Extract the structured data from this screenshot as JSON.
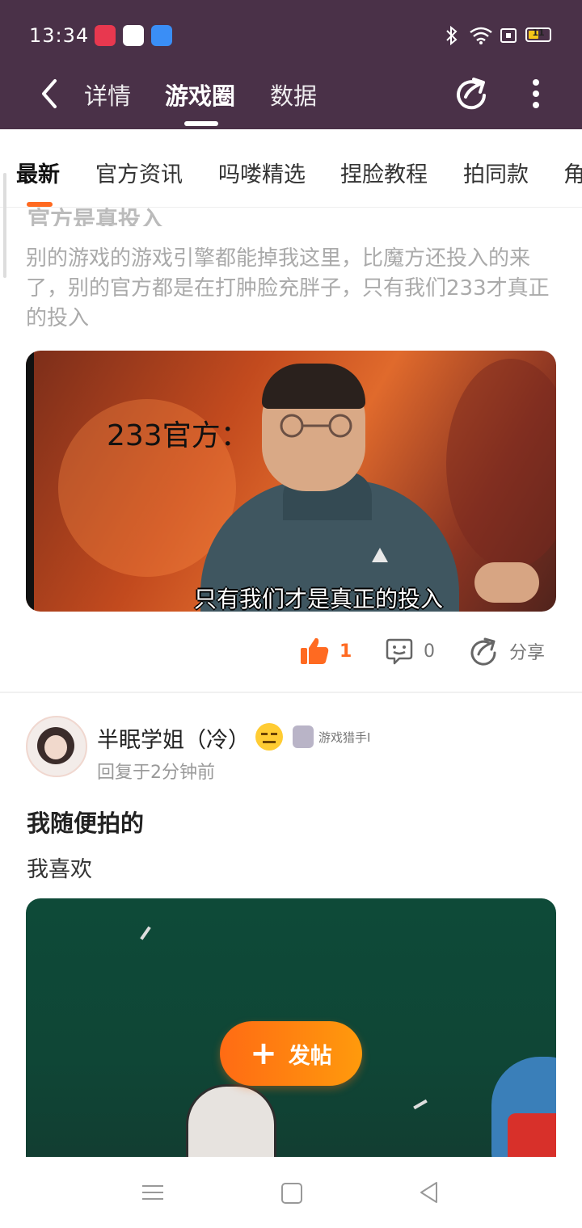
{
  "status_bar": {
    "time": "13:34",
    "battery_level": "11",
    "icons": [
      "screen-record-icon",
      "baidu-netdisk-icon",
      "cloud-icon",
      "bluetooth-icon",
      "wifi-icon",
      "vibrate-icon",
      "battery-icon"
    ]
  },
  "header": {
    "tabs": [
      "详情",
      "游戏圈",
      "数据"
    ],
    "active_tab": "游戏圈",
    "icons": [
      "back-icon",
      "share-icon",
      "more-icon"
    ]
  },
  "categories": {
    "items": [
      "最新",
      "官方资讯",
      "吗喽精选",
      "捏脸教程",
      "拍同款",
      "角"
    ],
    "active": "最新"
  },
  "post1": {
    "title_partial": "官方是真投入",
    "body": "别的游戏的游戏引擎都能掉我这里，比魔方还投入的来了，别的官方都是在打肿脸充胖子，只有我们233才真正的投入",
    "image_caption_top": "233官方：",
    "image_caption_bottom": "只有我们才是真正的投入",
    "likes": "1",
    "comments": "0",
    "share_label": "分享"
  },
  "post2": {
    "username": "半眠学姐（冷）",
    "badge_label": "游戏猎手I",
    "reply_time": "回复于2分钟前",
    "title": "我随便拍的",
    "body": "我喜欢"
  },
  "fab": {
    "label": "发帖"
  },
  "colors": {
    "header_bg": "#4a3148",
    "accent": "#ff6a21"
  }
}
